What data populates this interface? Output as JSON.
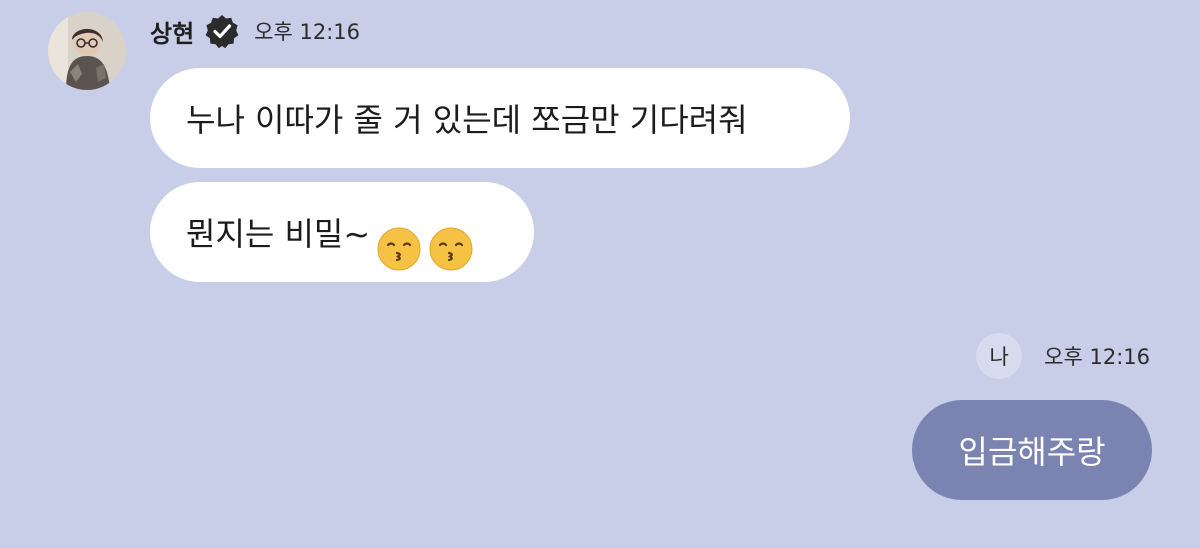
{
  "colors": {
    "background": "#c8cde8",
    "incoming_bubble": "#ffffff",
    "outgoing_bubble": "#7b84b1"
  },
  "incoming": {
    "sender_name": "상현",
    "verified_icon": "verified-badge-icon",
    "time": "오후 12:16",
    "messages": [
      {
        "text": "누나 이따가 줄 거 있는데 쪼금만 기다려줘"
      },
      {
        "text": "뭔지는 비밀~",
        "emoji": [
          "kissing-face-icon",
          "kissing-face-icon"
        ]
      }
    ]
  },
  "outgoing": {
    "me_label": "나",
    "time": "오후 12:16",
    "messages": [
      {
        "text": "입금해주랑"
      }
    ]
  }
}
